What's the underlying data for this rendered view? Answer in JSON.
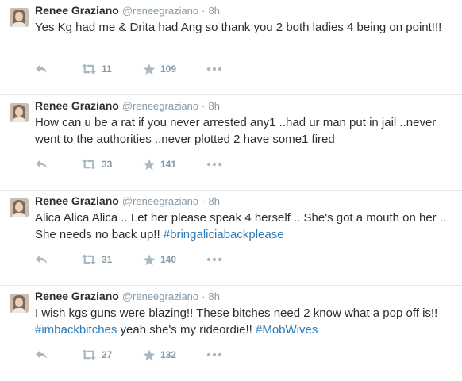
{
  "tweets": [
    {
      "fullname": "Renee Graziano",
      "username": "@reneegraziano",
      "time": "8h",
      "segments": [
        {
          "text": "Yes Kg had me & Drita had Ang so thank you 2 both ladies 4 being on point!!!",
          "hashtag": false
        }
      ],
      "retweets": "11",
      "favorites": "109"
    },
    {
      "fullname": "Renee Graziano",
      "username": "@reneegraziano",
      "time": "8h",
      "segments": [
        {
          "text": "How can u be a rat if you never arrested any1 ..had ur man put in jail ..never went to the authorities ..never plotted 2 have some1 fired",
          "hashtag": false
        }
      ],
      "retweets": "33",
      "favorites": "141"
    },
    {
      "fullname": "Renee Graziano",
      "username": "@reneegraziano",
      "time": "8h",
      "segments": [
        {
          "text": "Alica Alica Alica .. Let her please speak 4 herself .. She's got a mouth on her .. She needs no back up!! ",
          "hashtag": false
        },
        {
          "text": "#bringaliciabackplease",
          "hashtag": true
        }
      ],
      "retweets": "31",
      "favorites": "140"
    },
    {
      "fullname": "Renee Graziano",
      "username": "@reneegraziano",
      "time": "8h",
      "segments": [
        {
          "text": "I wish kgs guns were blazing!! These bitches need 2 know what a pop off is!! ",
          "hashtag": false
        },
        {
          "text": "#imbackbitches",
          "hashtag": true
        },
        {
          "text": " yeah she's my rideordie!! ",
          "hashtag": false
        },
        {
          "text": "#MobWives",
          "hashtag": true
        }
      ],
      "retweets": "27",
      "favorites": "132"
    }
  ],
  "separator": "·",
  "icons": {
    "reply": "reply-icon",
    "retweet": "retweet-icon",
    "favorite": "star-icon",
    "more": "more-icon"
  },
  "colors": {
    "text": "#292f33",
    "meta": "#8899a6",
    "icon": "#aab8c2",
    "hashtag": "#2b7bb9",
    "divider": "#e1e8ed"
  }
}
